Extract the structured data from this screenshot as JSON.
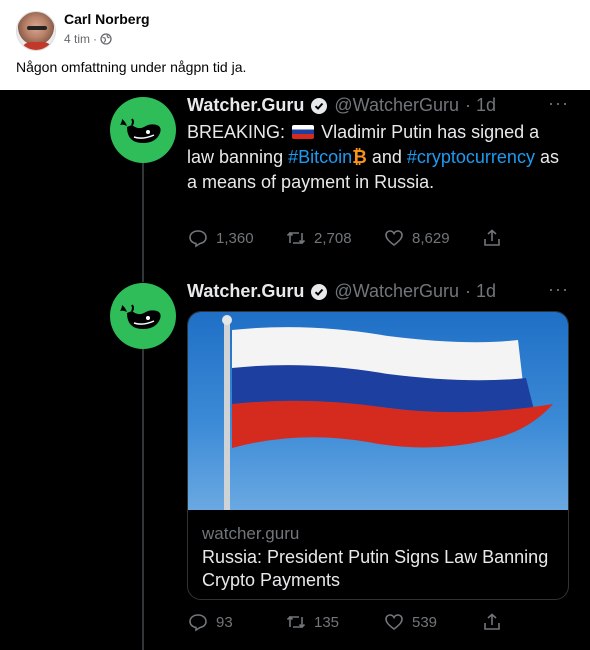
{
  "post": {
    "author": "Carl Norberg",
    "time": "4 tim",
    "separator": "·",
    "text": "Någon omfattning under någpn tid ja."
  },
  "tweets": [
    {
      "display_name": "Watcher.Guru",
      "handle": "@WatcherGuru",
      "age": "· 1d",
      "more": "···",
      "body": {
        "breaking": "BREAKING:",
        "part1": "Vladimir Putin has signed a law banning",
        "hashtag1": "#Bitcoin",
        "and": "and",
        "hashtag2": "#cryptocurrency",
        "part2": "as a means of payment in Russia."
      },
      "replies": "1,360",
      "retweets": "2,708",
      "likes": "8,629"
    },
    {
      "display_name": "Watcher.Guru",
      "handle": "@WatcherGuru",
      "age": "· 1d",
      "more": "···",
      "card": {
        "domain": "watcher.guru",
        "title": "Russia: President Putin Signs Law Banning Crypto Payments"
      },
      "replies": "93",
      "retweets": "135",
      "likes": "539"
    }
  ],
  "colors": {
    "tweet_bg": "#000000",
    "link_blue": "#1d9bf0",
    "avatar_green": "#2ebd59",
    "muted": "#71767b"
  },
  "icons": [
    "globe-icon",
    "whale-logo-icon",
    "verified-icon",
    "more-icon",
    "reply-icon",
    "retweet-icon",
    "like-icon",
    "share-icon",
    "russian-flag-icon",
    "bitcoin-icon"
  ]
}
